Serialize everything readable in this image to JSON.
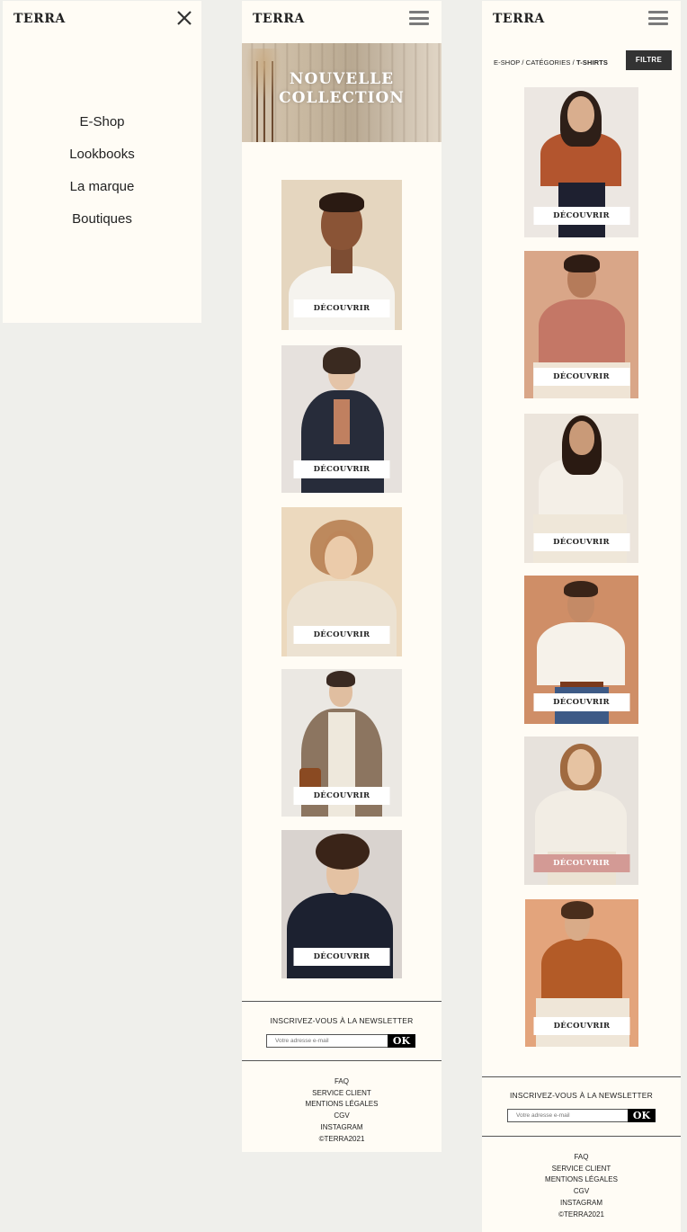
{
  "brand": "TERRA",
  "menu_panel": {
    "items": [
      "E-Shop",
      "Lookbooks",
      "La marque",
      "Boutiques"
    ]
  },
  "home_panel": {
    "hero_line1": "NOUVELLE",
    "hero_line2": "COLLECTION",
    "products": [
      {
        "button": "DÉCOUVRIR"
      },
      {
        "button": "DÉCOUVRIR"
      },
      {
        "button": "DÉCOUVRIR"
      },
      {
        "button": "DÉCOUVRIR"
      },
      {
        "button": "DÉCOUVRIR"
      }
    ]
  },
  "category_panel": {
    "breadcrumb": {
      "eshop": "E-SHOP",
      "categories": "CATÉGORIES",
      "current": "T-SHIRTS",
      "sep": " / "
    },
    "filter_label": "FILTRE",
    "products": [
      {
        "button": "DÉCOUVRIR"
      },
      {
        "button": "DÉCOUVRIR"
      },
      {
        "button": "DÉCOUVRIR"
      },
      {
        "button": "DÉCOUVRIR"
      },
      {
        "button": "DÉCOUVRIR",
        "hover": true
      },
      {
        "button": "DÉCOUVRIR"
      }
    ]
  },
  "newsletter": {
    "label": "INSCRIVEZ-VOUS À LA NEWSLETTER",
    "placeholder": "Votre adresse e-mail",
    "ok": "OK"
  },
  "footer": {
    "links": [
      "FAQ",
      "SERVICE CLIENT",
      "MENTIONS LÉGALES",
      "CGV",
      "INSTAGRAM"
    ],
    "copyright": "©TERRA2021"
  },
  "colors": {
    "panel_bg": "#fffcf5",
    "page_bg": "#efefeb",
    "hover_button": "#d39a95",
    "filter_bg": "#333333"
  }
}
